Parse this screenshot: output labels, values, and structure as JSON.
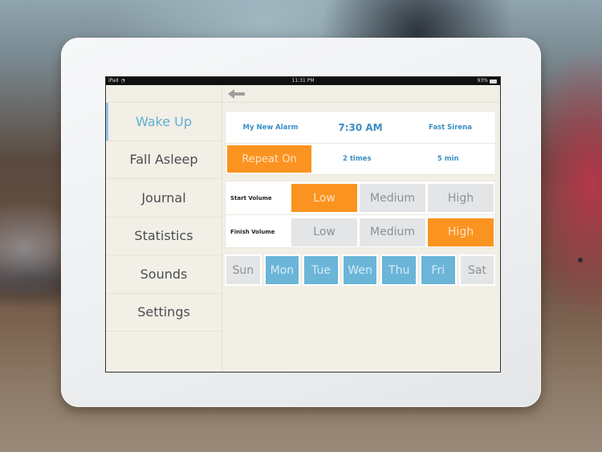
{
  "status_bar": {
    "carrier": "iPad",
    "time": "11:31 PM",
    "battery": "93%"
  },
  "nav": {
    "back_icon": "back-arrow-icon"
  },
  "sidebar": {
    "items": [
      {
        "label": "Wake Up",
        "active": true
      },
      {
        "label": "Fall Asleep",
        "active": false
      },
      {
        "label": "Journal",
        "active": false
      },
      {
        "label": "Statistics",
        "active": false
      },
      {
        "label": "Sounds",
        "active": false
      },
      {
        "label": "Settings",
        "active": false
      }
    ]
  },
  "alarm": {
    "name": "My New Alarm",
    "time": "7:30 AM",
    "sound": "Fast Sirena",
    "repeat_label": "Repeat On",
    "repeat_times": "2 times",
    "repeat_interval": "5 min"
  },
  "volume": {
    "start": {
      "label": "Start Volume",
      "options": [
        "Low",
        "Medium",
        "High"
      ],
      "selected": "Low"
    },
    "finish": {
      "label": "Finish Volume",
      "options": [
        "Low",
        "Medium",
        "High"
      ],
      "selected": "High"
    }
  },
  "days": [
    {
      "label": "Sun",
      "on": false
    },
    {
      "label": "Mon",
      "on": true
    },
    {
      "label": "Tue",
      "on": true
    },
    {
      "label": "Wen",
      "on": true
    },
    {
      "label": "Thu",
      "on": true
    },
    {
      "label": "Fri",
      "on": true
    },
    {
      "label": "Sat",
      "on": false
    }
  ],
  "colors": {
    "accent_orange": "#fb9320",
    "accent_blue": "#6bb5d8",
    "text_blue": "#3a8fc4",
    "inactive_gray": "#e3e5e6"
  }
}
